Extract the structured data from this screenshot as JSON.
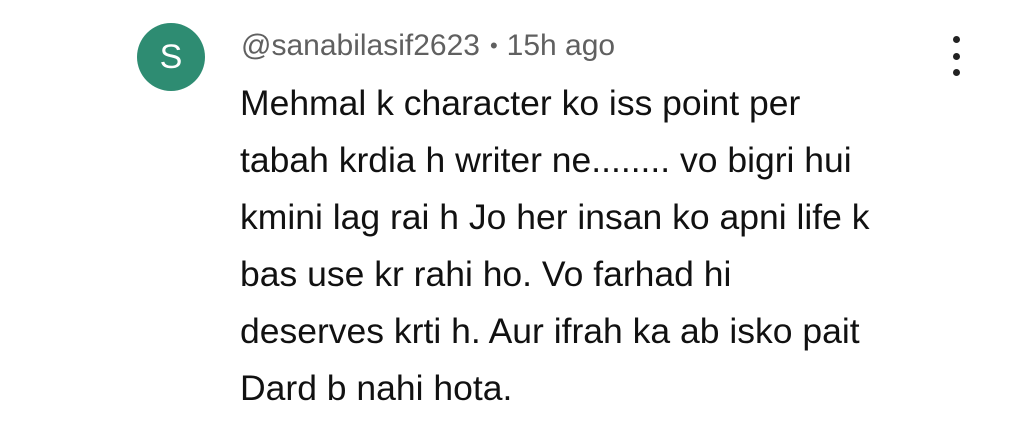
{
  "comment": {
    "avatar_letter": "S",
    "author": "@sanabilasif2623",
    "separator": "•",
    "time": "15h ago",
    "menu_icon": "more-vert-icon",
    "text_lines": [
      "Mehmal k character ko iss point per",
      "tabah krdia h writer ne........ vo bigri hui",
      "kmini lag rai h Jo her insan ko apni life k",
      "bas use kr rahi ho. Vo farhad hi",
      "deserves krti h. Aur ifrah ka ab isko pait",
      "Dard b nahi hota."
    ]
  },
  "colors": {
    "avatar_bg": "#2e8c72",
    "meta_text": "#606060",
    "body_text": "#111111"
  }
}
